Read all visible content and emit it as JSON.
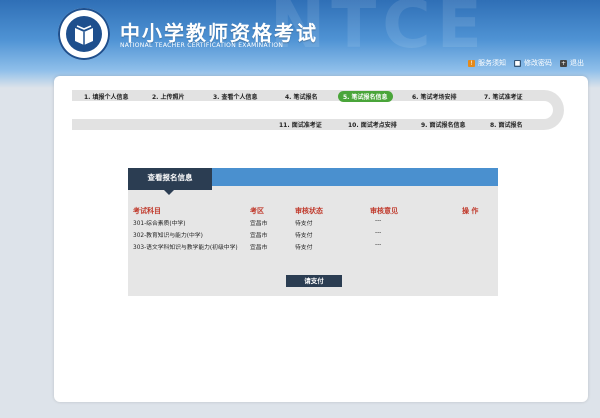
{
  "header": {
    "title": "中小学教师资格考试",
    "subtitle": "NATIONAL TEACHER CERTIFICATION EXAMINATION",
    "watermark": "NTCE",
    "links": [
      {
        "label": "服务须知",
        "icon": "info-icon"
      },
      {
        "label": "修改密码",
        "icon": "lock-icon"
      },
      {
        "label": "退出",
        "icon": "exit-icon"
      }
    ]
  },
  "steps": {
    "top": [
      "1. 填报个人信息",
      "2. 上传照片",
      "3. 查看个人信息",
      "4. 笔试报名",
      "5. 笔试报名信息",
      "6. 笔试考场安排",
      "7. 笔试准考证"
    ],
    "bottom": [
      "11. 面试准考证",
      "10. 面试考点安排",
      "9. 面试报名信息",
      "8. 面试报名"
    ],
    "active": "5. 笔试报名信息"
  },
  "info": {
    "tab_title": "查看报名信息",
    "columns": [
      "考试科目",
      "考区",
      "审核状态",
      "审核意见",
      "操  作"
    ],
    "rows": [
      [
        "301-综合素质(中学)",
        "宜昌市",
        "待支付",
        "---",
        ""
      ],
      [
        "302-教育知识与能力(中学)",
        "宜昌市",
        "待支付",
        "---",
        ""
      ],
      [
        "303-语文学科知识与教学能力(初级中学)",
        "宜昌市",
        "待支付",
        "---",
        ""
      ]
    ],
    "pay_button": "请支付"
  },
  "colors": {
    "header_blue": "#2f6fb6",
    "active_step": "#4aa53a",
    "tab_dark": "#2b3d52",
    "header_bar": "#4a90cf",
    "column_red": "#c0392b"
  }
}
